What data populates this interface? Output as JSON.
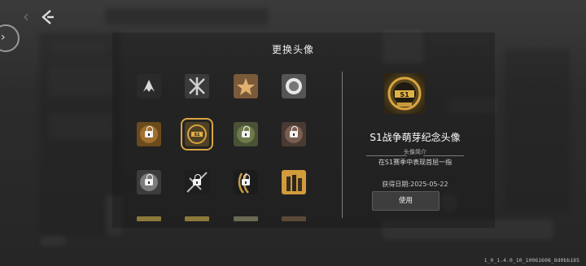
{
  "dialog": {
    "title": "更换头像"
  },
  "grid": {
    "rows": [
      [
        {
          "icon": "winged-emblem-icon",
          "locked": false,
          "selected": false
        },
        {
          "icon": "shattered-shield-icon",
          "locked": false,
          "selected": false
        },
        {
          "icon": "star-badge-icon",
          "locked": false,
          "selected": false
        },
        {
          "icon": "lion-head-icon",
          "locked": false,
          "selected": false
        }
      ],
      [
        {
          "icon": "s1-badge-icon",
          "locked": true,
          "selected": false
        },
        {
          "icon": "s1-badge-gold-icon",
          "locked": false,
          "selected": true
        },
        {
          "icon": "s1-badge-green-icon",
          "locked": true,
          "selected": false
        },
        {
          "icon": "s1-badge-bronze-icon",
          "locked": true,
          "selected": false
        }
      ],
      [
        {
          "icon": "s1-badge-silver-icon",
          "locked": true,
          "selected": false
        },
        {
          "icon": "shard-emblem-icon",
          "locked": true,
          "selected": false
        },
        {
          "icon": "claw-emblem-icon",
          "locked": true,
          "selected": false
        },
        {
          "icon": "soldiers-icon",
          "locked": false,
          "selected": false
        }
      ]
    ]
  },
  "detail": {
    "name": "S1战争萌芽纪念头像",
    "subtitle": "头像简介",
    "description": "在S1赛季中表现首屈一指",
    "obtained_date": "获得日期:2025-05-22",
    "use_label": "使用"
  },
  "footer": {
    "version": "1_0_1.4.0_10_10061608_8d0bb185"
  },
  "colors": {
    "accent": "#d9a441",
    "panel": "#3d3d3d"
  }
}
